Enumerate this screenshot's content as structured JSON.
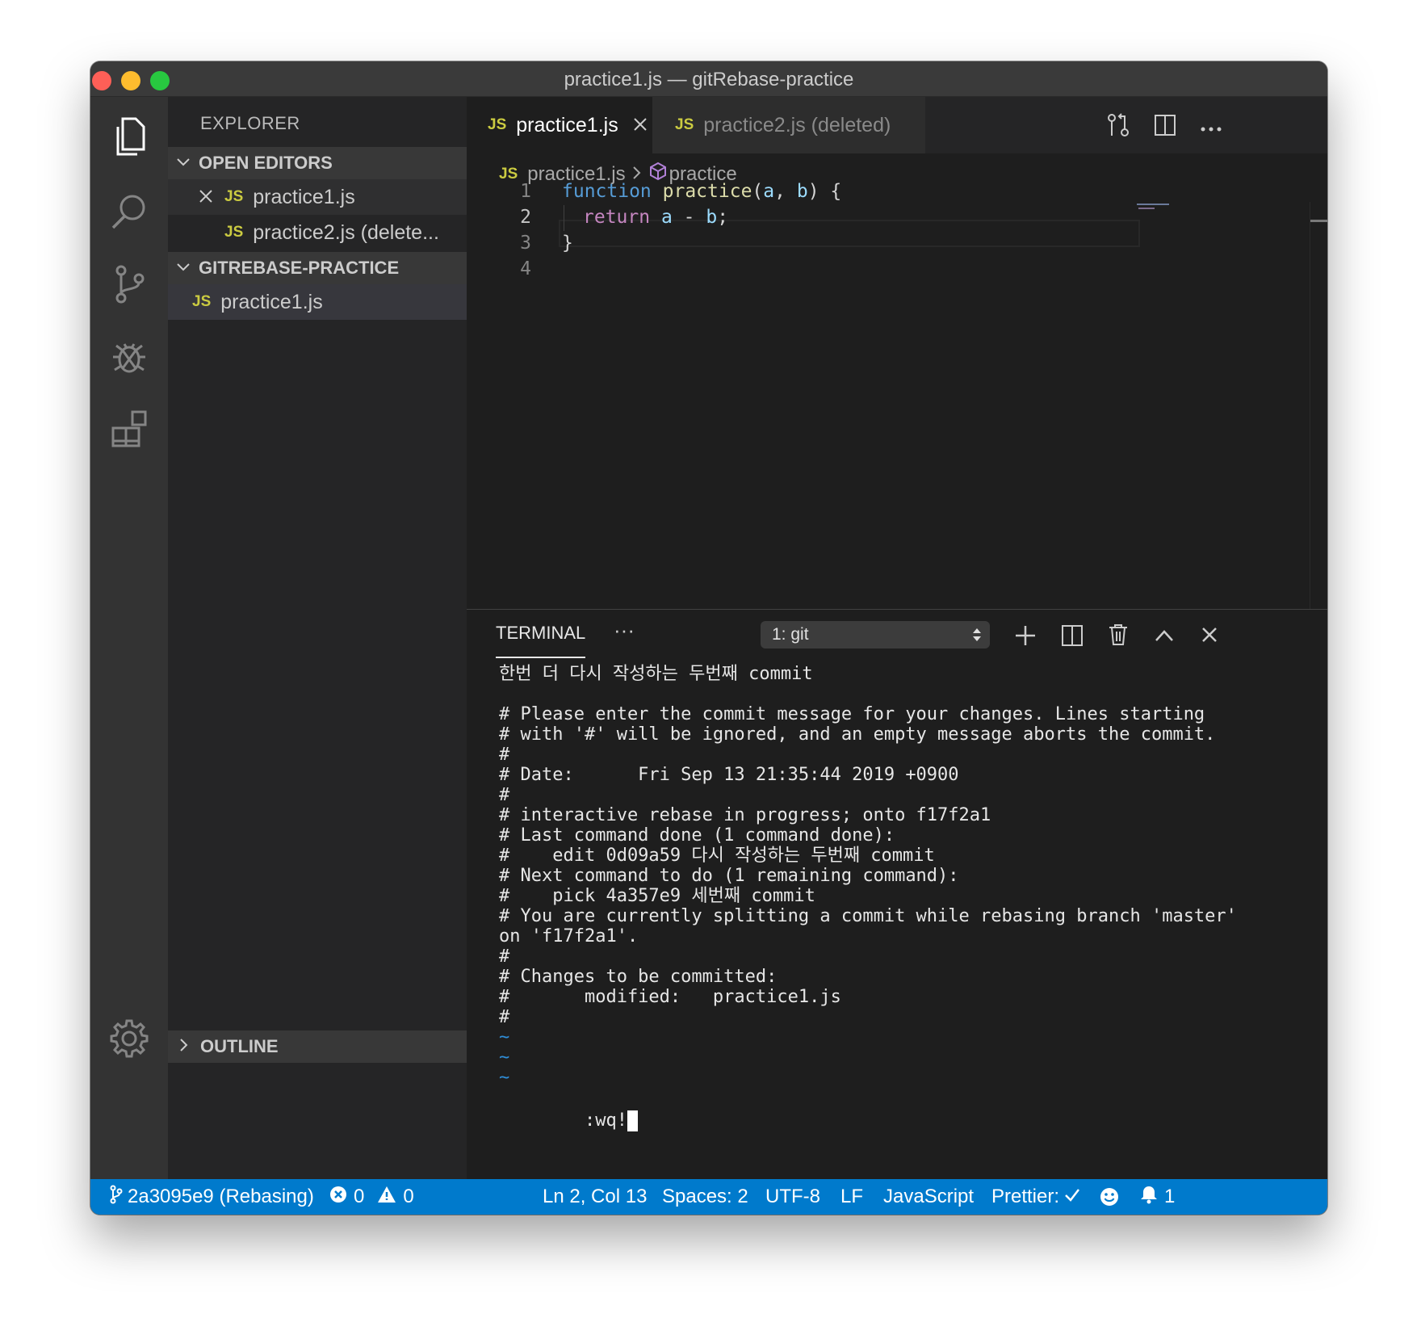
{
  "window": {
    "title": "practice1.js — gitRebase-practice"
  },
  "colors": {
    "activity_bar": "#333333",
    "sidebar": "#252526",
    "editor": "#1e1e1e",
    "status_bar": "#007acc",
    "js_badge": "#cbcb41",
    "keyword": "#569cd6",
    "function_name": "#dcdcaa",
    "param": "#9cdcfe",
    "return_keyword": "#c586c0",
    "vim_tilde": "#2f8ed8"
  },
  "activity_bar": {
    "icons": [
      "files-icon",
      "search-icon",
      "source-control-icon",
      "debug-icon",
      "extensions-icon",
      "settings-gear-icon"
    ]
  },
  "sidebar": {
    "title": "EXPLORER",
    "open_editors": {
      "label": "OPEN EDITORS",
      "items": [
        {
          "badge": "JS",
          "name": "practice1.js"
        },
        {
          "badge": "JS",
          "name": "practice2.js (delete..."
        }
      ]
    },
    "project": {
      "label": "GITREBASE-PRACTICE",
      "items": [
        {
          "badge": "JS",
          "name": "practice1.js"
        }
      ]
    },
    "outline_label": "OUTLINE"
  },
  "editor": {
    "tabs": [
      {
        "badge": "JS",
        "label": "practice1.js",
        "active": true
      },
      {
        "badge": "JS",
        "label": "practice2.js (deleted)",
        "active": false
      }
    ],
    "breadcrumb": {
      "badge": "JS",
      "file": "practice1.js",
      "symbol": "practice"
    },
    "line_numbers": [
      "1",
      "2",
      "3",
      "4"
    ],
    "code": {
      "l1_kw": "function",
      "l1_fn": "practice",
      "l1_open": "(",
      "l1_a": "a",
      "l1_comma": ", ",
      "l1_b": "b",
      "l1_close": ") {",
      "l2_kw": "return",
      "l2_a": "a",
      "l2_op": " - ",
      "l2_b": "b",
      "l2_semi": ";",
      "l3": "}"
    }
  },
  "panel": {
    "tab_label": "TERMINAL",
    "more_label": "···",
    "terminal_select": "1: git",
    "lines": [
      "한번 더 다시 작성하는 두번째 commit",
      "",
      "# Please enter the commit message for your changes. Lines starting",
      "# with '#' will be ignored, and an empty message aborts the commit.",
      "#",
      "# Date:      Fri Sep 13 21:35:44 2019 +0900",
      "#",
      "# interactive rebase in progress; onto f17f2a1",
      "# Last command done (1 command done):",
      "#    edit 0d09a59 다시 작성하는 두번째 commit",
      "# Next command to do (1 remaining command):",
      "#    pick 4a357e9 세번째 commit",
      "# You are currently splitting a commit while rebasing branch 'master'",
      "on 'f17f2a1'.",
      "#",
      "# Changes to be committed:",
      "#       modified:   practice1.js",
      "#"
    ],
    "tildes": [
      "~",
      "~",
      "~"
    ],
    "prompt": ":wq!"
  },
  "status_bar": {
    "branch": "2a3095e9 (Rebasing)",
    "errors": "0",
    "warnings": "0",
    "position": "Ln 2, Col 13",
    "spaces": "Spaces: 2",
    "encoding": "UTF-8",
    "eol": "LF",
    "language": "JavaScript",
    "prettier": "Prettier:",
    "notifications": "1"
  }
}
